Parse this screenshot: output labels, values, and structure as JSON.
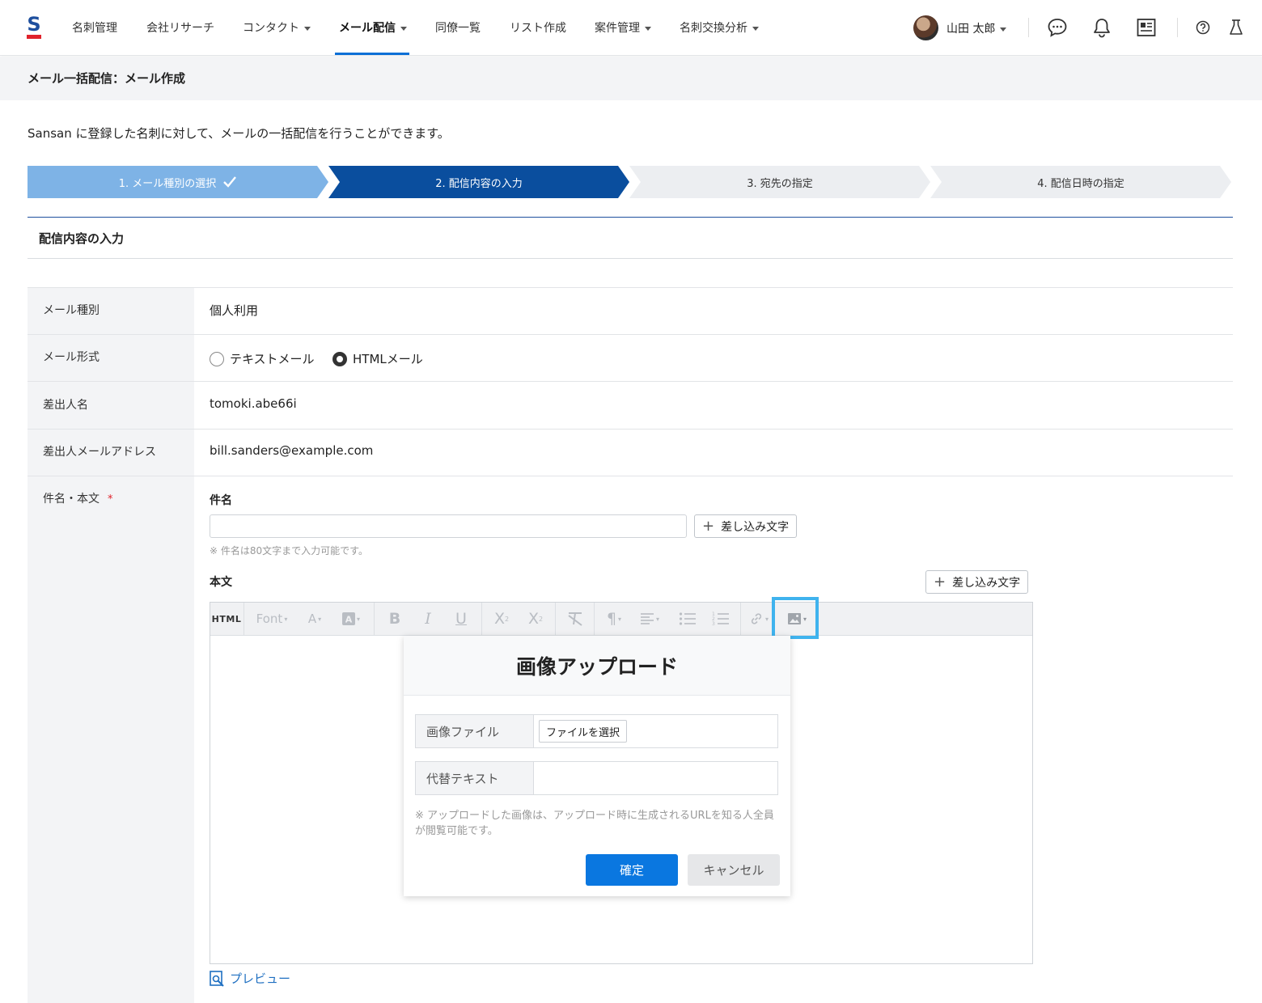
{
  "nav": {
    "items": [
      {
        "label": "名刺管理",
        "dropdown": false
      },
      {
        "label": "会社リサーチ",
        "dropdown": false
      },
      {
        "label": "コンタクト",
        "dropdown": true
      },
      {
        "label": "メール配信",
        "dropdown": true,
        "active": true
      },
      {
        "label": "同僚一覧",
        "dropdown": false
      },
      {
        "label": "リスト作成",
        "dropdown": false
      },
      {
        "label": "案件管理",
        "dropdown": true
      },
      {
        "label": "名刺交換分析",
        "dropdown": true
      }
    ],
    "user_name": "山田 太郎",
    "icons": [
      "chat-icon",
      "bell-icon",
      "news-icon",
      "help-icon",
      "labs-icon"
    ]
  },
  "page": {
    "title": "メール一括配信：メール作成",
    "intro": "Sansan に登録した名刺に対して、メールの一括配信を行うことができます。"
  },
  "steps": [
    {
      "label": "1. メール種別の選択",
      "state": "done"
    },
    {
      "label": "2. 配信内容の入力",
      "state": "current"
    },
    {
      "label": "3. 宛先の指定",
      "state": "todo"
    },
    {
      "label": "4. 配信日時の指定",
      "state": "todo"
    }
  ],
  "section": {
    "title": "配信内容の入力"
  },
  "form": {
    "mail_type_label": "メール種別",
    "mail_type_value": "個人利用",
    "format_label": "メール形式",
    "format_text": "テキストメール",
    "format_html": "HTMLメール",
    "format_selected": "HTMLメール",
    "sender_name_label": "差出人名",
    "sender_name_value": "tomoki.abe66i",
    "sender_email_label": "差出人メールアドレス",
    "sender_email_value": "bill.sanders@example.com",
    "subject_body_label": "件名・本文",
    "required_mark": "*",
    "subject_label": "件名",
    "subject_value": "",
    "insert_label": "差し込み文字",
    "subject_note": "※ 件名は80文字まで入力可能です。",
    "body_label": "本文",
    "preview_label": "プレビュー"
  },
  "toolbar": {
    "html": "HTML",
    "font": "Font",
    "font_color": "A",
    "bold": "B",
    "italic": "I",
    "underline": "U",
    "subscript": "X",
    "superscript": "X",
    "paragraph": "¶"
  },
  "dialog": {
    "title": "画像アップロード",
    "file_label": "画像ファイル",
    "file_button": "ファイルを選択",
    "alt_label": "代替テキスト",
    "alt_value": "",
    "note": "※ アップロードした画像は、アップロード時に生成されるURLを知る人全員が閲覧可能です。",
    "ok": "確定",
    "cancel": "キャンセル"
  },
  "colors": {
    "brand": "#1e4f9e",
    "accent": "#0a77e0",
    "step_done": "#7eb3e6",
    "step_current": "#0a4e9e",
    "step_todo": "#eceef1",
    "highlight": "#3fb3ee",
    "required": "#e0222b"
  }
}
